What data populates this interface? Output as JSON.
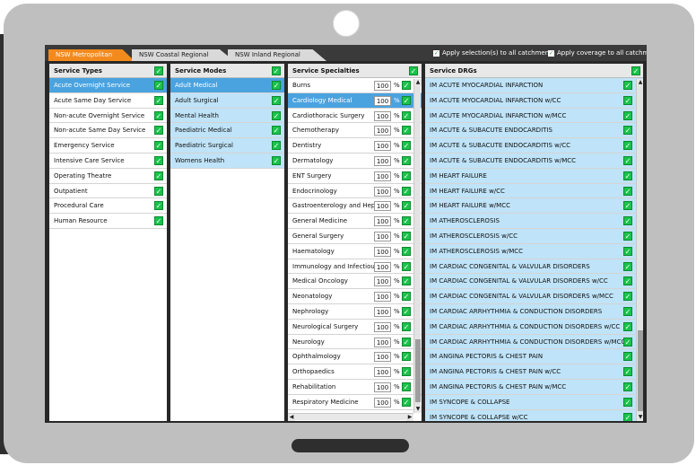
{
  "tabs": [
    {
      "label": "NSW Metropolitan",
      "active": true
    },
    {
      "label": "NSW Coastal Regional",
      "active": false
    },
    {
      "label": "NSW Inland Regional",
      "active": false
    }
  ],
  "apply_selection_label": "Apply selection(s) to all catchments",
  "apply_coverage_label": "Apply coverage to all catchments",
  "service_types": {
    "header": "Service Types",
    "items": [
      {
        "label": "Acute Overnight Service",
        "selected": true
      },
      {
        "label": "Acute Same Day Service"
      },
      {
        "label": "Non-acute Overnight Service"
      },
      {
        "label": "Non-acute Same Day Service"
      },
      {
        "label": "Emergency Service"
      },
      {
        "label": "Intensive Care Service"
      },
      {
        "label": "Operating Theatre"
      },
      {
        "label": "Outpatient"
      },
      {
        "label": "Procedural Care"
      },
      {
        "label": "Human Resource"
      }
    ]
  },
  "service_modes": {
    "header": "Service Modes",
    "items": [
      {
        "label": "Adult Medical",
        "selected": true
      },
      {
        "label": "Adult Surgical"
      },
      {
        "label": "Mental Health"
      },
      {
        "label": "Paediatric Medical"
      },
      {
        "label": "Paediatric Surgical"
      },
      {
        "label": "Womens Health"
      }
    ]
  },
  "service_specialties": {
    "header": "Service Specialties",
    "percent_symbol": "%",
    "items": [
      {
        "label": "Burns",
        "pct": "100"
      },
      {
        "label": "Cardiology Medical",
        "pct": "100",
        "selected": true
      },
      {
        "label": "Cardiothoracic Surgery",
        "pct": "100"
      },
      {
        "label": "Chemotherapy",
        "pct": "100"
      },
      {
        "label": "Dentistry",
        "pct": "100"
      },
      {
        "label": "Dermatology",
        "pct": "100"
      },
      {
        "label": "ENT Surgery",
        "pct": "100"
      },
      {
        "label": "Endocrinology",
        "pct": "100"
      },
      {
        "label": "Gastroenterology and Hepat...",
        "pct": "100"
      },
      {
        "label": "General Medicine",
        "pct": "100"
      },
      {
        "label": "General Surgery",
        "pct": "100"
      },
      {
        "label": "Haematology",
        "pct": "100"
      },
      {
        "label": "Immunology and Infectious ...",
        "pct": "100"
      },
      {
        "label": "Medical Oncology",
        "pct": "100"
      },
      {
        "label": "Neonatology",
        "pct": "100"
      },
      {
        "label": "Nephrology",
        "pct": "100"
      },
      {
        "label": "Neurological Surgery",
        "pct": "100"
      },
      {
        "label": "Neurology",
        "pct": "100"
      },
      {
        "label": "Ophthalmology",
        "pct": "100"
      },
      {
        "label": "Orthopaedics",
        "pct": "100"
      },
      {
        "label": "Rehabilitation",
        "pct": "100"
      },
      {
        "label": "Respiratory Medicine",
        "pct": "100"
      }
    ]
  },
  "service_drgs": {
    "header": "Service DRGs",
    "items": [
      "IM ACUTE MYOCARDIAL INFARCTION",
      "IM ACUTE MYOCARDIAL INFARCTION w/CC",
      "IM ACUTE MYOCARDIAL INFARCTION w/MCC",
      "IM ACUTE & SUBACUTE ENDOCARDITIS",
      "IM ACUTE & SUBACUTE ENDOCARDITIS w/CC",
      "IM ACUTE & SUBACUTE ENDOCARDITIS w/MCC",
      "IM HEART FAILURE",
      "IM HEART FAILURE w/CC",
      "IM HEART FAILURE w/MCC",
      "IM ATHEROSCLEROSIS",
      "IM ATHEROSCLEROSIS w/CC",
      "IM ATHEROSCLEROSIS w/MCC",
      "IM CARDIAC CONGENITAL & VALVULAR DISORDERS",
      "IM CARDIAC CONGENITAL & VALVULAR DISORDERS w/CC",
      "IM CARDIAC CONGENITAL & VALVULAR DISORDERS w/MCC",
      "IM CARDIAC ARRHYTHMIA & CONDUCTION DISORDERS",
      "IM CARDIAC ARRHYTHMIA & CONDUCTION DISORDERS w/CC",
      "IM CARDIAC ARRHYTHMIA & CONDUCTION DISORDERS w/MCC",
      "IM ANGINA PECTORIS & CHEST PAIN",
      "IM ANGINA PECTORIS & CHEST PAIN w/CC",
      "IM ANGINA PECTORIS & CHEST PAIN w/MCC",
      "IM SYNCOPE & COLLAPSE",
      "IM SYNCOPE & COLLAPSE w/CC"
    ]
  },
  "colors": {
    "accent_tab": "#f28a1e",
    "selected_row": "#4aa3df",
    "drg_row": "#bfe3f8",
    "check": "#19c34b"
  },
  "icons": {
    "check": "checkmark-icon",
    "scroll_up": "arrow-up-icon",
    "scroll_down": "arrow-down-icon",
    "scroll_left": "arrow-left-icon",
    "scroll_right": "arrow-right-icon"
  }
}
